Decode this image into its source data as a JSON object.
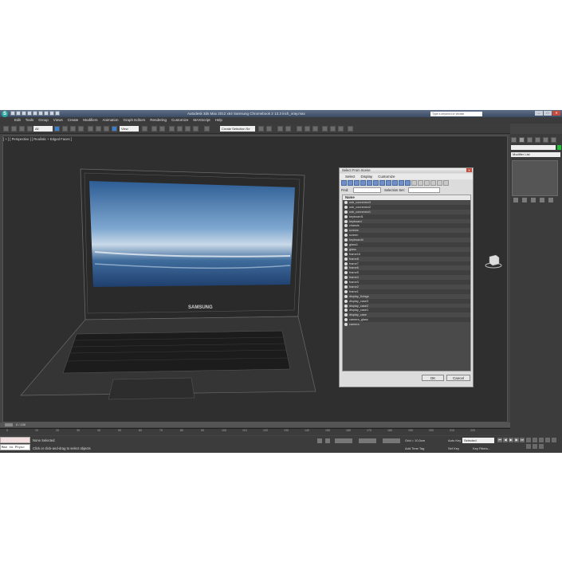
{
  "app": {
    "title": "Autodesk 3ds Max 2012 x64     Samsung Chromebook 2 13.3 inch_vray.max",
    "search_placeholder": "Type a keyword or phrase",
    "logo_letter": "S"
  },
  "menu": [
    "Edit",
    "Tools",
    "Group",
    "Views",
    "Create",
    "Modifiers",
    "Animation",
    "Graph Editors",
    "Rendering",
    "Customize",
    "MAXScript",
    "Help"
  ],
  "toolbar": {
    "filter_select": "All",
    "view_select": "View",
    "named_selection": "Create Selection Se"
  },
  "viewport": {
    "label": "[ + ] [ Perspective ] [ Realistic + Edged Faces ]",
    "brand_text": "SAMSUNG"
  },
  "command_panel": {
    "modifier_list": "Modifier List",
    "object_color": "#21c03b"
  },
  "dialog": {
    "title": "Select From Scene",
    "menu": [
      "Select",
      "Display",
      "Customize"
    ],
    "find_label": "Find:",
    "selection_set_label": "Selection Set:",
    "column_header": "Name",
    "items": [
      "usb_connector3",
      "usb_connector2",
      "usb_connector1",
      "keyboard1",
      "keyboard",
      "chassis",
      "screws",
      "screen",
      "keyboard4",
      "glass1",
      "glass",
      "frame16",
      "frame8",
      "frame7",
      "frame6",
      "frame5",
      "frame4",
      "frame3",
      "frame2",
      "frame1",
      "display_fixings",
      "display_case3",
      "display_case2",
      "display_case1",
      "display_case",
      "camera_glass",
      "camera"
    ],
    "ok_label": "OK",
    "cancel_label": "Cancel"
  },
  "timeline": {
    "counter": "0 / 100",
    "ticks": [
      "0",
      "10",
      "20",
      "30",
      "40",
      "50",
      "60",
      "70",
      "80",
      "90",
      "100",
      "110",
      "120",
      "130",
      "140",
      "150",
      "160",
      "170",
      "180",
      "190",
      "200",
      "210",
      "220"
    ]
  },
  "status": {
    "maxscript_text": "Max to Physc",
    "line1": "None Selected",
    "line2": "Click or click-and-drag to select objects",
    "grid": "Grid = 10,0cm",
    "add_time_tag": "Add Time Tag",
    "auto_key": "Auto Key",
    "selected": "Selected",
    "set_key": "Set Key",
    "key_filters": "Key Filters..."
  }
}
